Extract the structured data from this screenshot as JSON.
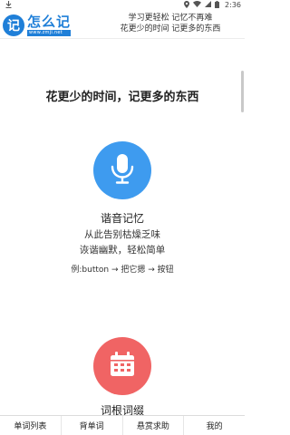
{
  "status": {
    "time": "2:36",
    "icons": [
      "download-icon",
      "location-icon",
      "wifi-icon",
      "signal-icon",
      "battery-icon"
    ]
  },
  "header": {
    "logo_mark": "记",
    "logo_title": "怎么记",
    "logo_url": "www.zmji.net",
    "slogan_line1": "学习更轻松 记忆不再难",
    "slogan_line2": "花更少的时间 记更多的东西"
  },
  "main": {
    "headline": "花更少的时间，记更多的东西",
    "voice": {
      "icon": "microphone-icon",
      "title": "谐音记忆",
      "desc1": "从此告别枯燥乏味",
      "desc2": "诙谐幽默，轻松简单",
      "example": "例:button → 把它摁 → 按钮"
    },
    "root": {
      "icon": "calendar-icon",
      "title": "词根词缀"
    }
  },
  "nav": {
    "items": [
      "单词列表",
      "背单词",
      "悬赏求助",
      "我的"
    ]
  },
  "colors": {
    "brand": "#1f7fd8",
    "voice_accent": "#3e9bef",
    "root_accent": "#f06464"
  }
}
